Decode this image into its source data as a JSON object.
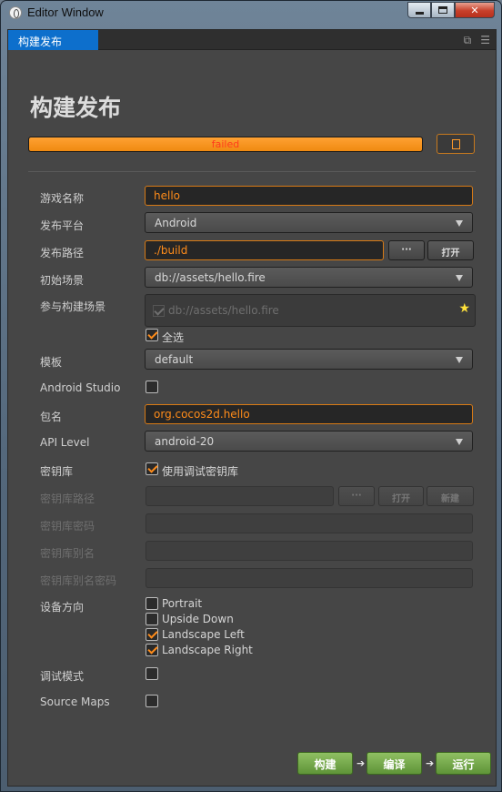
{
  "window": {
    "title": "Editor Window",
    "tab_label": "构建发布"
  },
  "page": {
    "title": "构建发布"
  },
  "build_progress": {
    "status_text": "failed",
    "percent": 100
  },
  "fields": {
    "game_name": {
      "label": "游戏名称",
      "value": "hello"
    },
    "platform": {
      "label": "发布平台",
      "value": "Android"
    },
    "build_path": {
      "label": "发布路径",
      "value": "./build",
      "browse_label": "···",
      "open_label": "打开"
    },
    "start_scene": {
      "label": "初始场景",
      "value": "db://assets/hello.fire"
    },
    "scenes": {
      "label": "参与构建场景",
      "items": [
        "db://assets/hello.fire"
      ],
      "select_all_label": "全选"
    },
    "template": {
      "label": "模板",
      "value": "default"
    },
    "android_studio": {
      "label": "Android Studio"
    },
    "package_name": {
      "label": "包名",
      "value": "org.cocos2d.hello"
    },
    "api_level": {
      "label": "API Level",
      "value": "android-20"
    },
    "keystore": {
      "label": "密钥库",
      "use_debug_label": "使用调试密钥库"
    },
    "keystore_path": {
      "label": "密钥库路径",
      "browse_label": "···",
      "open_label": "打开",
      "new_label": "新建"
    },
    "keystore_password": {
      "label": "密钥库密码"
    },
    "keystore_alias": {
      "label": "密钥库别名"
    },
    "keystore_alias_password": {
      "label": "密钥库别名密码"
    },
    "orientation": {
      "label": "设备方向",
      "options": [
        {
          "label": "Portrait",
          "checked": false
        },
        {
          "label": "Upside Down",
          "checked": false
        },
        {
          "label": "Landscape Left",
          "checked": true
        },
        {
          "label": "Landscape Right",
          "checked": true
        }
      ]
    },
    "debug_mode": {
      "label": "调试模式"
    },
    "source_maps": {
      "label": "Source Maps"
    }
  },
  "actions": {
    "build_label": "构建",
    "compile_label": "编译",
    "run_label": "运行"
  },
  "colors": {
    "accent_orange": "#ff8c1a",
    "tab_blue": "#0d6fcc",
    "action_green": "#6fa447",
    "failed_red": "#ff3b1d"
  }
}
